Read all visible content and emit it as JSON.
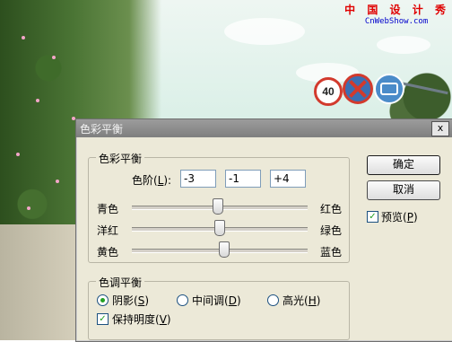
{
  "watermark": {
    "line1": "中 国 设 计 秀",
    "line2": "CnWebShow.com"
  },
  "sign_speed": "40",
  "dialog": {
    "title": "色彩平衡",
    "close_glyph": "x",
    "color_balance": {
      "group_title": "色彩平衡",
      "levels_label": "色阶(",
      "levels_key": "L",
      "levels_label_end": "):",
      "levels": [
        "-3",
        "-1",
        "+4"
      ],
      "sliders": [
        {
          "left": "青色",
          "right": "红色",
          "value": -3
        },
        {
          "left": "洋红",
          "right": "绿色",
          "value": -1
        },
        {
          "left": "黄色",
          "right": "蓝色",
          "value": 4
        }
      ],
      "slider_range": [
        -100,
        100
      ]
    },
    "tone_balance": {
      "group_title": "色调平衡",
      "shadows": {
        "text": "阴影(",
        "key": "S",
        "end": ")",
        "selected": true
      },
      "midtones": {
        "text": "中间调(",
        "key": "D",
        "end": ")",
        "selected": false
      },
      "highlights": {
        "text": "高光(",
        "key": "H",
        "end": ")",
        "selected": false
      },
      "preserve": {
        "text": "保持明度(",
        "key": "V",
        "end": ")",
        "checked": true
      }
    },
    "buttons": {
      "ok": "确定",
      "cancel": "取消"
    },
    "preview": {
      "text": "预览(",
      "key": "P",
      "end": ")",
      "checked": true
    },
    "check_glyph": "✓"
  }
}
